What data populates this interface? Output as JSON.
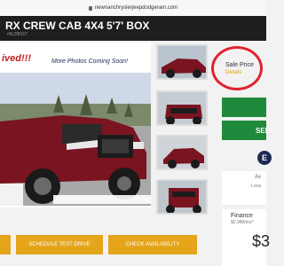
{
  "browser": {
    "url": "newnanchryslerjeepdodgeram.com"
  },
  "header": {
    "title": "RX CREW CAB 4X4 5'7' BOX",
    "stock": "#NJ28167"
  },
  "ad": {
    "red_text": "ived!!!",
    "more_photos": "More Photos Coming Soon!"
  },
  "pricing": {
    "label": "Sale Price",
    "details_link": "Details",
    "button_text": "SELL"
  },
  "dealer_logo_letter": "E",
  "availability": {
    "label": "Av",
    "sub": "Loca"
  },
  "finance": {
    "label": "Finance",
    "sub": "$2,986/mo*",
    "amount": "$3"
  },
  "actions": [
    {
      "label": ""
    },
    {
      "label": "SCHEDULE TEST DRIVE"
    },
    {
      "label": "CHECK AVAILABILITY"
    }
  ],
  "colors": {
    "accent_gold": "#e4a51b",
    "cta_green": "#1f8a3c",
    "header_bg": "#1e1e1e",
    "truck_red": "#7a1420"
  }
}
